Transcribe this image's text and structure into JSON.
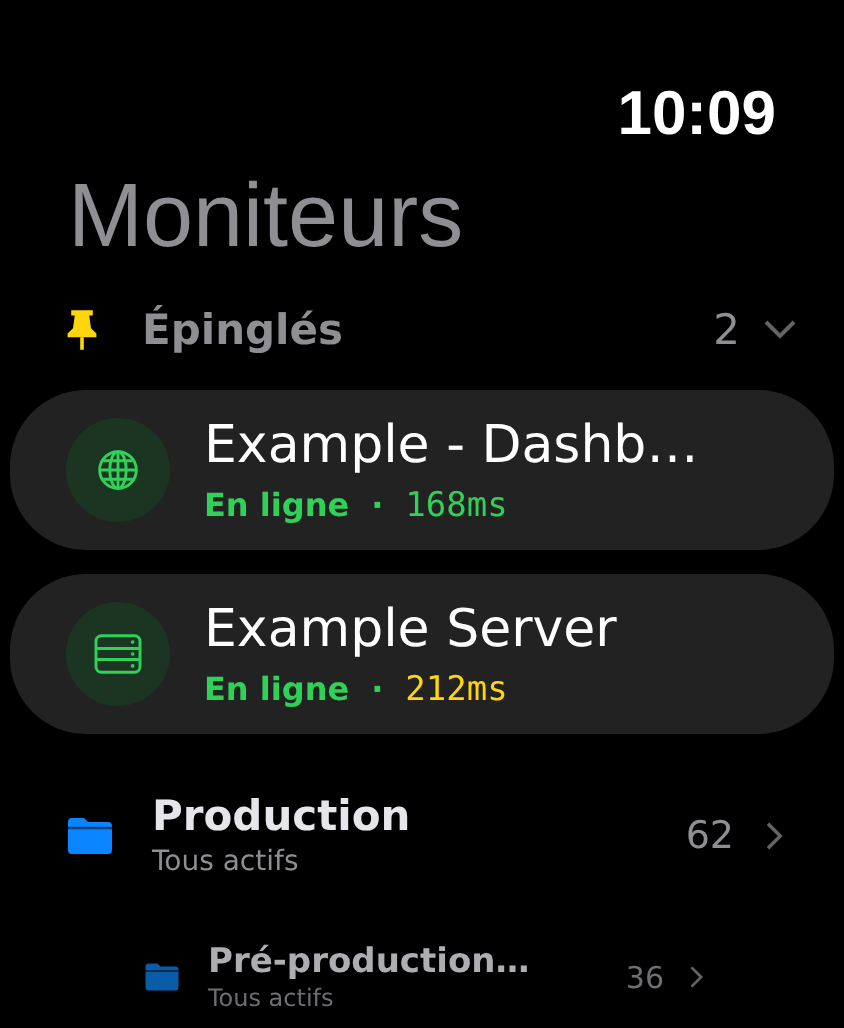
{
  "status_bar": {
    "time": "10:09"
  },
  "title": "Moniteurs",
  "pinned": {
    "label": "Épinglés",
    "count": "2",
    "expanded": true,
    "monitors": [
      {
        "kind": "web",
        "name": "Example - Dashb…",
        "status": "En ligne",
        "separator": "·",
        "latency": "168ms",
        "color": "#30d158"
      },
      {
        "kind": "server",
        "name": "Example Server",
        "status": "En ligne",
        "separator": "·",
        "latency": "212ms",
        "color": "#ffd60a"
      }
    ]
  },
  "groups": [
    {
      "name": "Production",
      "subtitle": "Tous actifs",
      "count": "62",
      "faded": false
    },
    {
      "name": "Pré-production…",
      "subtitle": "Tous actifs",
      "count": "36",
      "faded": true
    }
  ]
}
